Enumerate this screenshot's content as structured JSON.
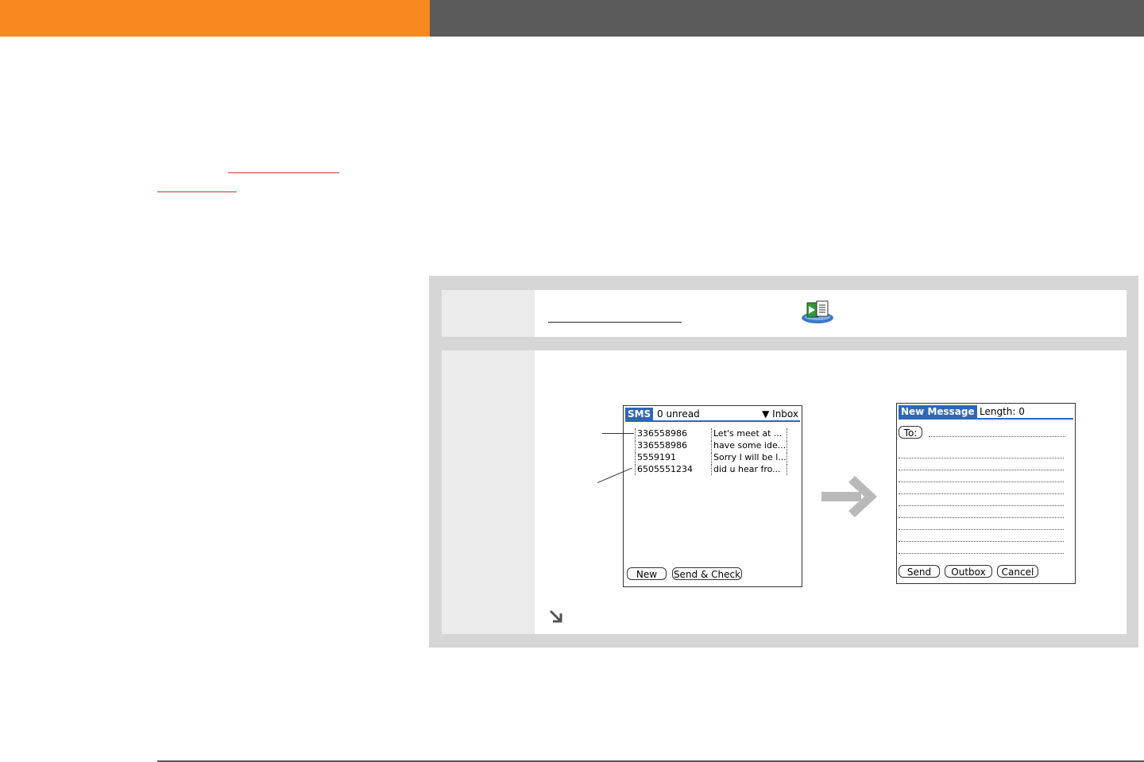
{
  "sms_screen": {
    "tab": "SMS",
    "unread": "0 unread",
    "folder": "Inbox",
    "messages": [
      {
        "sender": "336558986",
        "preview": "Let's meet at ..."
      },
      {
        "sender": "336558986",
        "preview": "have some ide..."
      },
      {
        "sender": "5559191",
        "preview": "Sorry I will be l..."
      },
      {
        "sender": "6505551234",
        "preview": "did u hear fro..."
      }
    ],
    "buttons": {
      "new": "New",
      "send_check": "Send & Check"
    }
  },
  "new_message_screen": {
    "tab": "New Message",
    "length": "Length: 0",
    "to": "To:",
    "buttons": {
      "send": "Send",
      "outbox": "Outbox",
      "cancel": "Cancel"
    }
  },
  "icons": {
    "app": "sms-application-icon",
    "arrow": "right-arrow-icon",
    "continue": "continue-arrow-icon"
  },
  "colors": {
    "header_orange": "#f7891f",
    "header_gray": "#5b5b5b",
    "tab_blue": "#2f67b5"
  }
}
